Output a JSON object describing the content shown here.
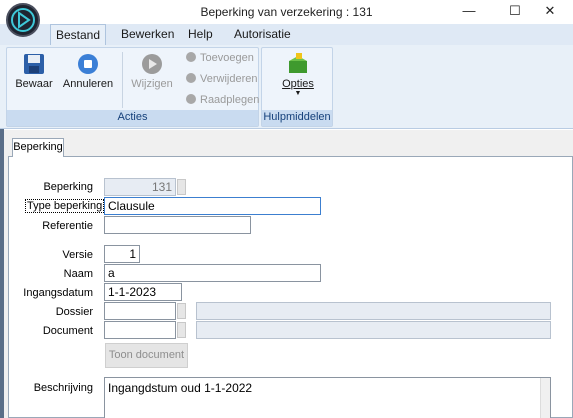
{
  "window": {
    "title": "Beperking van verzekering : 131",
    "minimize": "—",
    "maximize": "☐",
    "close": "✕"
  },
  "ribbon_tabs": [
    "Bestand",
    "Bewerken",
    "Help",
    "Autorisatie"
  ],
  "ribbon": {
    "acties": {
      "caption": "Acties",
      "bewaar": "Bewaar",
      "annuleren": "Annuleren",
      "wijzigen": "Wijzigen",
      "toevoegen": "Toevoegen",
      "verwijderen": "Verwijderen",
      "raadplegen": "Raadplegen"
    },
    "hulpmiddelen": {
      "caption": "Hulpmiddelen",
      "opties": "Opties"
    }
  },
  "form_tab": "Beperking",
  "form": {
    "beperking": {
      "label": "Beperking",
      "value": "131"
    },
    "type_beperking": {
      "label": "Type beperking",
      "value": "Clausule"
    },
    "referentie": {
      "label": "Referentie",
      "value": ""
    },
    "versie": {
      "label": "Versie",
      "value": "1"
    },
    "naam": {
      "label": "Naam",
      "value": "a"
    },
    "ingangsdatum": {
      "label": "Ingangsdatum",
      "value": "1-1-2023"
    },
    "dossier": {
      "label": "Dossier",
      "value": ""
    },
    "document": {
      "label": "Document",
      "value": ""
    },
    "toon_document": "Toon document",
    "beschrijving": {
      "label": "Beschrijving",
      "value": "Ingangdstum oud 1-1-2022"
    }
  }
}
